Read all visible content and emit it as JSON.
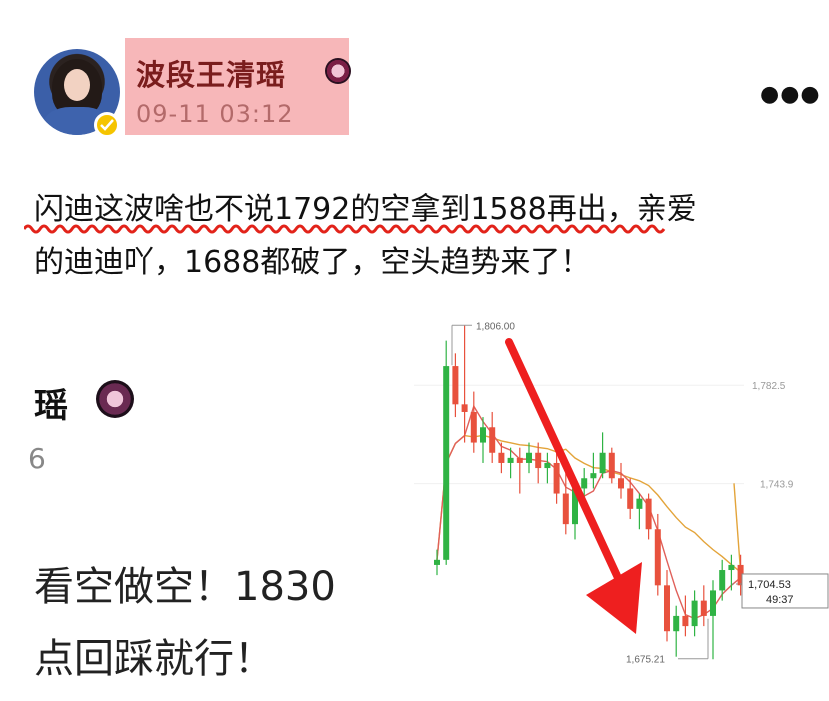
{
  "author": {
    "name": "波段王清瑶",
    "timestamp": "09-11 03:12"
  },
  "post": {
    "line1": "闪迪这波啥也不说1792的空拿到1588再出，亲爱",
    "line2": "的迪迪吖，1688都破了，空头趋势来了！"
  },
  "embedded_screenshot": {
    "name_fragment": "瑶",
    "timestamp_fragment": "6",
    "text_line1": "看空做空！1830",
    "text_line2": "点回踩就行！"
  },
  "chart_data": {
    "type": "candlestick",
    "labels": {
      "high": "1,806.00",
      "low": "1,675.21",
      "axis_top": "1,782.5",
      "axis_mid": "1,743.9",
      "current_price": "1,704.53",
      "countdown": "49:37"
    },
    "candles": [
      [
        1712,
        1718,
        1708,
        1714
      ],
      [
        1714,
        1800,
        1712,
        1790
      ],
      [
        1790,
        1795,
        1770,
        1775
      ],
      [
        1775,
        1806,
        1760,
        1772
      ],
      [
        1772,
        1780,
        1756,
        1760
      ],
      [
        1760,
        1770,
        1752,
        1766
      ],
      [
        1766,
        1772,
        1752,
        1756
      ],
      [
        1756,
        1760,
        1748,
        1752
      ],
      [
        1752,
        1758,
        1746,
        1754
      ],
      [
        1754,
        1758,
        1740,
        1752
      ],
      [
        1752,
        1760,
        1748,
        1756
      ],
      [
        1756,
        1760,
        1744,
        1750
      ],
      [
        1750,
        1756,
        1744,
        1752
      ],
      [
        1752,
        1756,
        1736,
        1740
      ],
      [
        1740,
        1748,
        1724,
        1728
      ],
      [
        1728,
        1744,
        1722,
        1742
      ],
      [
        1742,
        1750,
        1736,
        1746
      ],
      [
        1746,
        1756,
        1742,
        1748
      ],
      [
        1748,
        1764,
        1746,
        1756
      ],
      [
        1756,
        1758,
        1744,
        1746
      ],
      [
        1746,
        1752,
        1738,
        1742
      ],
      [
        1742,
        1746,
        1730,
        1734
      ],
      [
        1734,
        1740,
        1726,
        1738
      ],
      [
        1738,
        1740,
        1722,
        1726
      ],
      [
        1726,
        1732,
        1700,
        1704
      ],
      [
        1704,
        1710,
        1682,
        1686
      ],
      [
        1686,
        1696,
        1676,
        1692
      ],
      [
        1692,
        1700,
        1684,
        1688
      ],
      [
        1688,
        1702,
        1684,
        1698
      ],
      [
        1698,
        1704,
        1688,
        1692
      ],
      [
        1692,
        1706,
        1675,
        1702
      ],
      [
        1702,
        1714,
        1698,
        1710
      ],
      [
        1710,
        1716,
        1702,
        1712
      ],
      [
        1712,
        1716,
        1700,
        1704
      ]
    ]
  },
  "colors": {
    "name_highlight": "#f7b7b9",
    "up": "#2fb344",
    "down": "#e8513d",
    "arrow": "#ee1f1f",
    "squiggle": "#e2231a",
    "ma_short": "#e0605a",
    "ma_long": "#e3a43a"
  },
  "icons": {
    "verified": "verified-check-icon",
    "badge": "flower-badge-icon",
    "more": "more-dots-icon"
  }
}
